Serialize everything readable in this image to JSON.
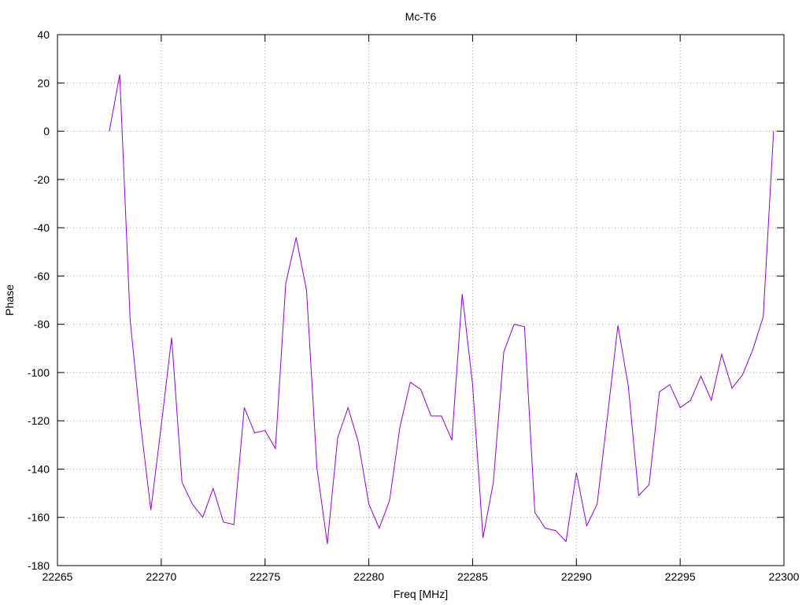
{
  "chart_data": {
    "type": "line",
    "title": "Mc-T6",
    "xlabel": "Freq [MHz]",
    "ylabel": "Phase",
    "xlim": [
      22265,
      22300
    ],
    "ylim": [
      -180,
      40
    ],
    "xticks": [
      "22265",
      "22270",
      "22275",
      "22280",
      "22285",
      "22290",
      "22295",
      "22300"
    ],
    "yticks": [
      "40",
      "20",
      "0",
      "-20",
      "-40",
      "-60",
      "-80",
      "-100",
      "-120",
      "-140",
      "-160",
      "-180"
    ],
    "grid": true,
    "legend": "none",
    "series": [
      {
        "color": "#9400d3",
        "x": [
          22267.5,
          22268.0,
          22268.5,
          22269.0,
          22269.5,
          22270.0,
          22270.5,
          22271.0,
          22271.5,
          22272.0,
          22272.5,
          22273.0,
          22273.5,
          22274.0,
          22274.5,
          22275.0,
          22275.5,
          22276.0,
          22276.5,
          22277.0,
          22277.5,
          22278.0,
          22278.5,
          22279.0,
          22279.5,
          22280.0,
          22280.5,
          22281.0,
          22281.5,
          22282.0,
          22282.5,
          22283.0,
          22283.5,
          22284.0,
          22284.5,
          22285.0,
          22285.5,
          22286.0,
          22286.5,
          22287.0,
          22287.5,
          22288.0,
          22288.5,
          22289.0,
          22289.5,
          22290.0,
          22290.5,
          22291.0,
          22291.5,
          22292.0,
          22292.5,
          22293.0,
          22293.5,
          22294.0,
          22294.5,
          22295.0,
          22295.5,
          22296.0,
          22296.5,
          22297.0,
          22297.5,
          22298.0,
          22298.5,
          22299.0,
          22299.5
        ],
        "y": [
          0,
          23.5,
          -78,
          -121,
          -157,
          -122,
          -85.5,
          -145.5,
          -154.5,
          -160,
          -148,
          -162,
          -163,
          -114.5,
          -125,
          -124,
          -131.5,
          -63,
          -44,
          -66,
          -139.5,
          -171,
          -127,
          -114.5,
          -129,
          -154.5,
          -164.5,
          -153,
          -122.5,
          -104,
          -107,
          -118,
          -118,
          -128,
          -67.5,
          -105,
          -168.5,
          -145.5,
          -91.5,
          -80,
          -81,
          -158,
          -164.5,
          -165.5,
          -170,
          -141.5,
          -163.5,
          -154.5,
          -118,
          -80.5,
          -105.5,
          -151,
          -146.5,
          -108,
          -105,
          -114.5,
          -111.5,
          -101.5,
          -111.5,
          -92.5,
          -106.5,
          -101,
          -90.5,
          -77,
          0
        ]
      }
    ]
  }
}
